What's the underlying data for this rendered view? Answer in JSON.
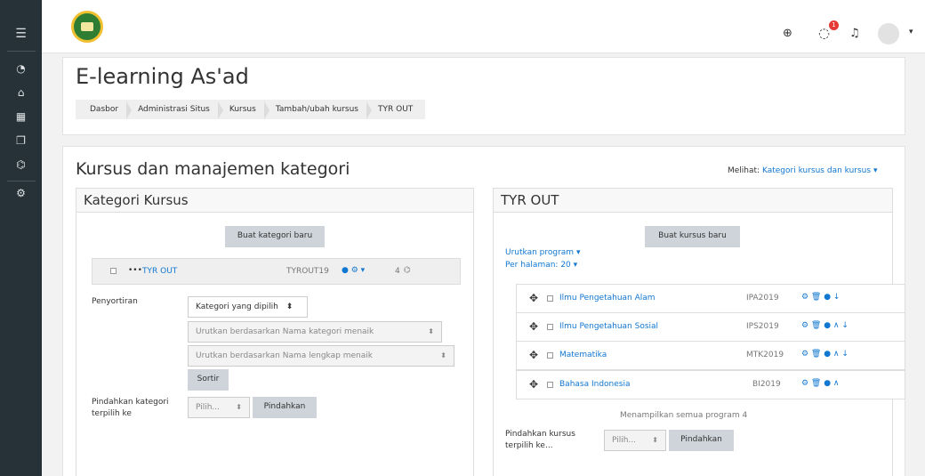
{
  "sidebar": {
    "menu_icon": "☰",
    "items": [
      {
        "icon": "dashboard-icon",
        "glyph": "◔"
      },
      {
        "icon": "home-icon",
        "glyph": "⌂"
      },
      {
        "icon": "calendar-icon",
        "glyph": "▦"
      },
      {
        "icon": "files-icon",
        "glyph": "❐"
      },
      {
        "icon": "graduation-cap-icon",
        "glyph": "⌬"
      },
      {
        "icon": "gear-icon",
        "glyph": "⚙"
      }
    ]
  },
  "topbar": {
    "language_glyph": "⊕",
    "messages_glyph": "◌",
    "notification_count": "1",
    "bell_glyph": "♫",
    "user_menu_caret": "▾"
  },
  "header": {
    "site_title": "E-learning As'ad",
    "breadcrumbs": [
      "Dasbor",
      "Administrasi Situs",
      "Kursus",
      "Tambah/ubah kursus",
      "TYR OUT"
    ]
  },
  "main": {
    "page_title": "Kursus dan manajemen kategori",
    "viewing_label": "Melihat:",
    "viewing_value": "Kategori kursus dan kursus",
    "viewing_caret": "▾"
  },
  "categories_panel": {
    "title": "Kategori Kursus",
    "create_button": "Buat kategori baru",
    "category": {
      "name": "TYR OUT",
      "idnumber": "TYROUT19",
      "dots": "•••",
      "count": "4",
      "actions": "● ⚙ ▾",
      "count_icon": "⌬"
    },
    "sort_label": "Penyortiran",
    "sort_select": "Kategori yang dipilih",
    "sort_option_1": "Urutkan berdasarkan Nama kategori menaik",
    "sort_option_2": "Urutkan berdasarkan Nama lengkap menaik",
    "sort_button": "Sortir",
    "move_label": "Pindahkan kategori terpilih ke",
    "move_select": "Pilih...",
    "move_button": "Pindahkan",
    "select_caret": "⬍"
  },
  "courses_panel": {
    "title": "TYR OUT",
    "create_button": "Buat kursus baru",
    "sort_programs": "Urutkan program",
    "per_page": "Per halaman: 20",
    "caret": "▾",
    "courses": [
      {
        "name": "Ilmu Pengetahuan Alam",
        "idnumber": "IPA2019",
        "actions": "⚙ 🗑 ● ↓"
      },
      {
        "name": "Ilmu Pengetahuan Sosial",
        "idnumber": "IPS2019",
        "actions": "⚙ 🗑 ● ∧ ↓"
      },
      {
        "name": "Matematika",
        "idnumber": "MTK2019",
        "actions": "⚙ 🗑 ● ∧ ↓"
      },
      {
        "name": "Bahasa Indonesia",
        "idnumber": "BI2019",
        "actions": "⚙ 🗑 ● ∧"
      }
    ],
    "move_handle": "✥",
    "showing_text": "Menampilkan semua program 4",
    "move_label": "Pindahkan kursus terpilih ke...",
    "move_select": "Pilih...",
    "move_button": "Pindahkan",
    "select_caret": "⬍"
  }
}
